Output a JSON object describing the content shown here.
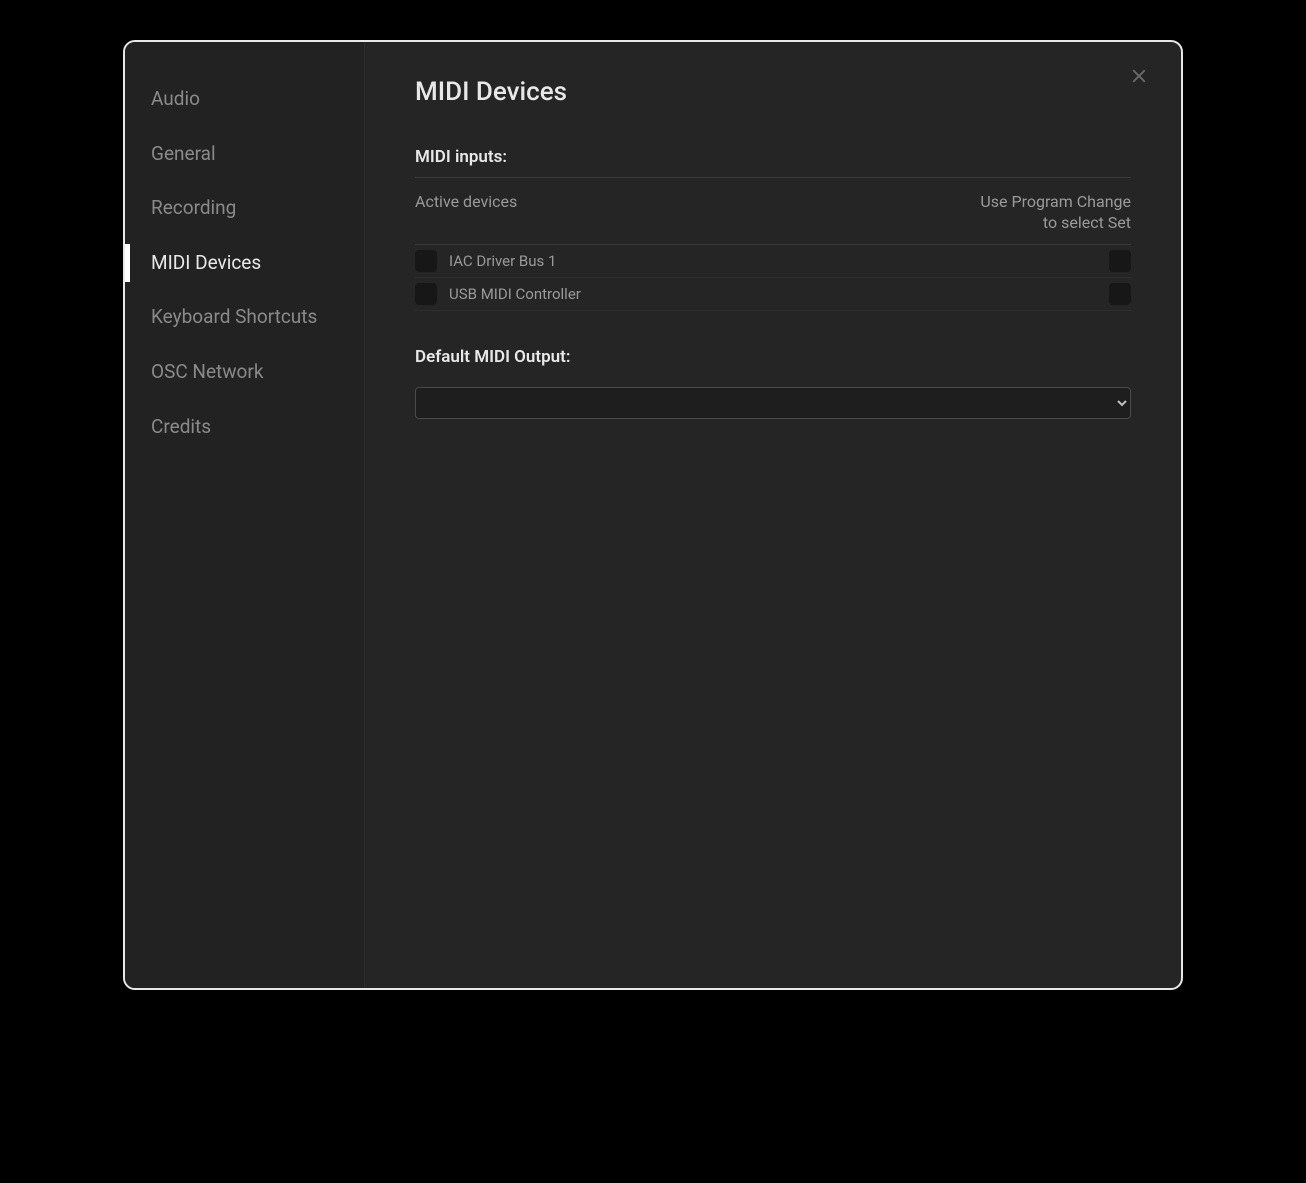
{
  "sidebar": {
    "items": [
      {
        "label": "Audio"
      },
      {
        "label": "General"
      },
      {
        "label": "Recording"
      },
      {
        "label": "MIDI Devices"
      },
      {
        "label": "Keyboard Shortcuts"
      },
      {
        "label": "OSC Network"
      },
      {
        "label": "Credits"
      }
    ],
    "active_index": 3
  },
  "page": {
    "title": "MIDI Devices"
  },
  "midi_inputs": {
    "section_label": "MIDI inputs:",
    "col_active": "Active devices",
    "col_pc_line1": "Use Program Change",
    "col_pc_line2": "to select Set",
    "devices": [
      {
        "name": "IAC Driver Bus 1"
      },
      {
        "name": "USB MIDI Controller"
      }
    ]
  },
  "midi_output": {
    "section_label": "Default MIDI Output:",
    "selected": ""
  }
}
